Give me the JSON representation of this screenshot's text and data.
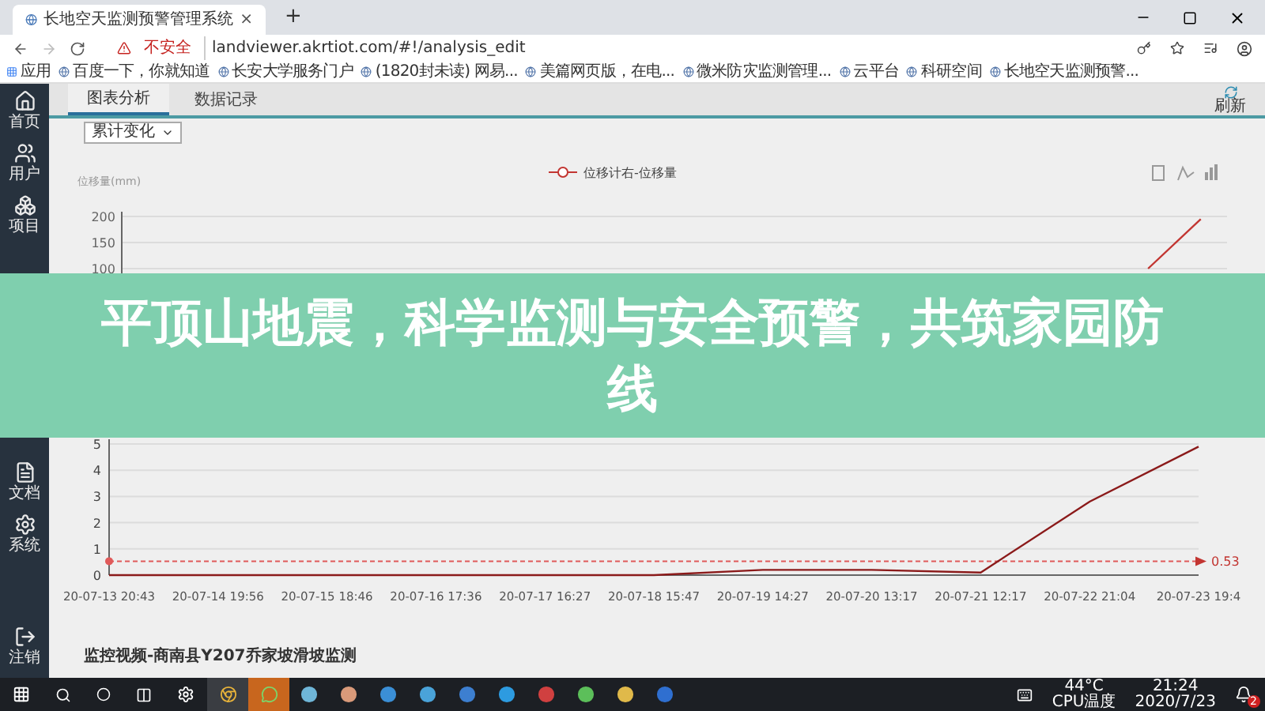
{
  "browser": {
    "tab_title": "长地空天监测预警管理系统",
    "tab_close": "×",
    "new_tab": "+",
    "security": "不安全",
    "url": "landviewer.akrtiot.com/#!/analysis_edit",
    "bookmarks": [
      "应用",
      "百度一下，你就知道",
      "长安大学服务门户",
      "(1820封未读) 网易...",
      "美篇网页版，在电...",
      "微米防灾监测管理...",
      "云平台",
      "科研空间",
      "长地空天监测预警..."
    ]
  },
  "sidebar": {
    "items": [
      {
        "label": "首页",
        "kind": "home",
        "selected": false
      },
      {
        "label": "用户",
        "kind": "users",
        "selected": false
      },
      {
        "label": "项目",
        "kind": "project",
        "selected": false
      }
    ],
    "lower_items": [
      {
        "label": "文档",
        "kind": "doc",
        "selected": false
      },
      {
        "label": "系统",
        "kind": "system",
        "selected": false
      }
    ],
    "logout": "注销"
  },
  "tabs": [
    {
      "label": "图表分析",
      "selected": true
    },
    {
      "label": "数据记录",
      "selected": false
    }
  ],
  "refresh": "刷新",
  "dropdown": {
    "value": "累计变化"
  },
  "chart1": {
    "ylabel": "位移量(mm)",
    "chart_data": {
      "type": "line",
      "ylim": [
        -50,
        200
      ],
      "yticks": [
        100,
        150,
        200
      ],
      "grid": true,
      "series": [
        {
          "name": "位移计右-位移量",
          "color": "#c23531",
          "values": [
            null,
            null,
            null,
            null,
            null,
            null,
            null,
            null,
            null,
            null,
            null,
            null,
            null,
            null,
            null,
            null,
            null,
            null,
            null,
            100,
            195
          ]
        }
      ]
    }
  },
  "chart2": {
    "chart_data": {
      "type": "line",
      "categories": [
        "20-07-13 20:43",
        "20-07-14 19:56",
        "20-07-15 18:46",
        "20-07-16 17:36",
        "20-07-17 16:27",
        "20-07-18 15:47",
        "20-07-19 14:27",
        "20-07-20 13:17",
        "20-07-21 12:17",
        "20-07-22 21:04",
        "20-07-23 19:4"
      ],
      "ylim": [
        0,
        5
      ],
      "yticks": [
        0,
        1,
        2,
        3,
        4,
        5
      ],
      "grid": true,
      "series": [
        {
          "color": "#8b1a1a",
          "values": [
            0,
            0,
            0,
            0,
            0,
            0,
            0.2,
            0.2,
            0.1,
            2.8,
            4.9
          ]
        }
      ],
      "ref_lines": [
        {
          "axis": "y",
          "value": 0.53,
          "label": "0.53",
          "color": "#e05a5a"
        }
      ]
    }
  },
  "video_title": "监控视频-商南县Y207乔家坡滑坡监测",
  "taskbar": {
    "temperature": "44°C",
    "temperature_label": "CPU温度",
    "time": "21:24",
    "date": "2020/7/23",
    "notifications": "2"
  },
  "banner": "平顶山地震，科学监测与安全预警，共筑家园防线"
}
